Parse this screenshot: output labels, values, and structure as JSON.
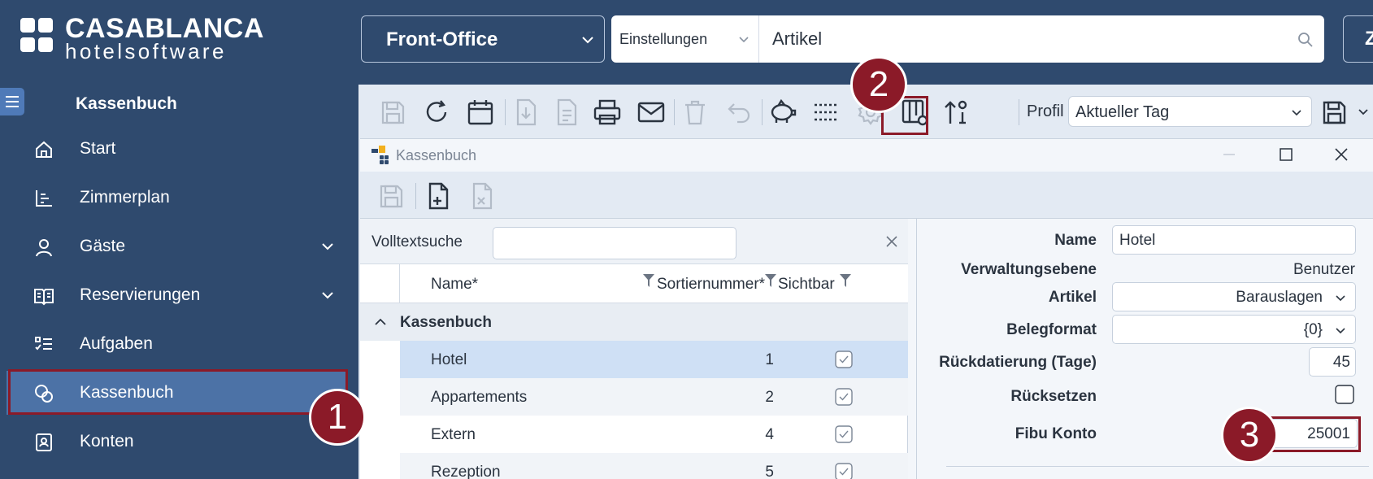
{
  "brand": {
    "name": "CASABLANCA",
    "tagline": "hotelsoftware"
  },
  "sidebar": {
    "heading": "Kassenbuch",
    "items": [
      {
        "label": "Start",
        "icon": "home-icon"
      },
      {
        "label": "Zimmerplan",
        "icon": "chart-icon"
      },
      {
        "label": "Gäste",
        "icon": "user-icon",
        "expandable": true
      },
      {
        "label": "Reservierungen",
        "icon": "book-icon",
        "expandable": true
      },
      {
        "label": "Aufgaben",
        "icon": "task-list-icon"
      },
      {
        "label": "Kassenbuch",
        "icon": "coins-icon",
        "active": true
      },
      {
        "label": "Konten",
        "icon": "account-icon"
      }
    ]
  },
  "header": {
    "module": "Front-Office",
    "search_category": "Einstellungen",
    "search_value": "Artikel"
  },
  "toolbar": {
    "buttons": [
      "save-icon",
      "refresh-icon",
      "calendar-icon",
      "export-icon",
      "document-icon",
      "print-icon",
      "mail-icon",
      "delete-icon",
      "undo-icon",
      "piggy-bank-icon",
      "list-icon",
      "settings-icon",
      "columns-settings-icon",
      "sort-icon"
    ],
    "profile_label": "Profil",
    "profile_value": "Aktueller Tag"
  },
  "callouts": [
    "1",
    "2",
    "3"
  ],
  "window": {
    "title": "Kassenbuch",
    "list": {
      "search_label": "Volltextsuche",
      "search_value": "",
      "columns": [
        "Name*",
        "Sortiernummer*",
        "Sichtbar"
      ],
      "group": "Kassenbuch",
      "rows": [
        {
          "name": "Hotel",
          "sort": "1",
          "visible": true,
          "selected": true
        },
        {
          "name": "Appartements",
          "sort": "2",
          "visible": true
        },
        {
          "name": "Extern",
          "sort": "4",
          "visible": true
        },
        {
          "name": "Rezeption",
          "sort": "5",
          "visible": true
        }
      ]
    },
    "detail": {
      "name_label": "Name",
      "name_value": "Hotel",
      "level_label": "Verwaltungsebene",
      "level_value": "Benutzer",
      "article_label": "Artikel",
      "article_value": "Barauslagen",
      "format_label": "Belegformat",
      "format_value": "{0}",
      "backdate_label": "Rückdatierung (Tage)",
      "backdate_value": "45",
      "reset_label": "Rücksetzen",
      "fibu_label": "Fibu Konto",
      "fibu_value": "25001"
    }
  },
  "colors": {
    "sidebar": "#2f4a6e",
    "active": "#4c72a6",
    "callout": "#8b1a28",
    "selected_row": "#cfe0f5"
  }
}
